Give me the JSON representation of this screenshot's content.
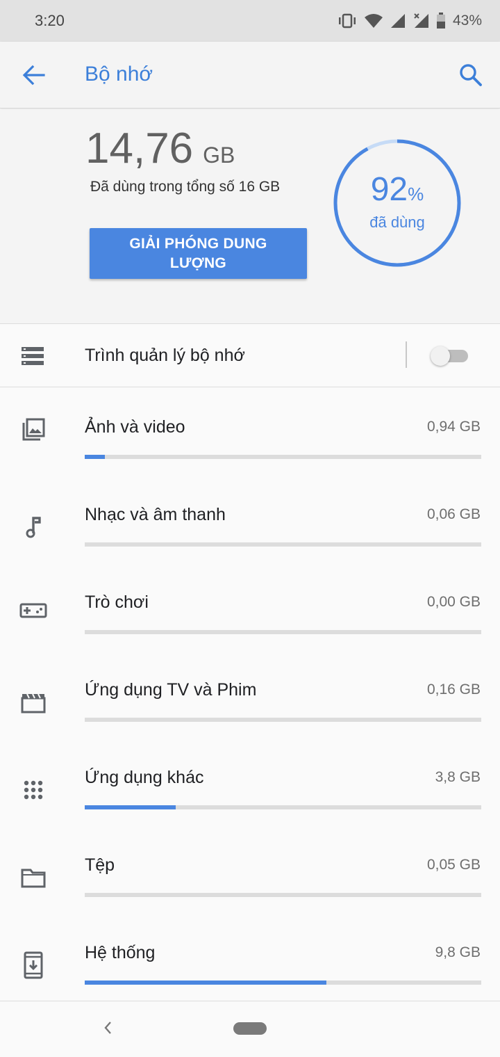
{
  "status_bar": {
    "time": "3:20",
    "battery_percent": "43%",
    "icons": [
      "vibrate-icon",
      "wifi-icon",
      "signal-icon",
      "signal-x-icon",
      "battery-icon"
    ]
  },
  "app_bar": {
    "title": "Bộ nhớ",
    "back_icon": "arrow-back-icon",
    "search_icon": "search-icon"
  },
  "summary": {
    "used_value": "14,76",
    "used_unit": "GB",
    "used_total_text": "Đã dùng trong tổng số 16 GB",
    "free_button_label": "GIẢI PHÓNG DUNG LƯỢNG",
    "percent_value": "92",
    "percent_sign": "%",
    "percent_fraction": 0.92,
    "percent_label": "đã dùng"
  },
  "storage_manager": {
    "label": "Trình quản lý bộ nhớ",
    "icon": "storage-list-icon",
    "enabled": false
  },
  "categories": [
    {
      "label": "Ảnh và video",
      "size": "0,94 GB",
      "fraction": 0.05,
      "icon": "photo-library-icon"
    },
    {
      "label": "Nhạc và âm thanh",
      "size": "0,06 GB",
      "fraction": 0.0,
      "icon": "music-note-icon"
    },
    {
      "label": "Trò chơi",
      "size": "0,00 GB",
      "fraction": 0.0,
      "icon": "gamepad-icon"
    },
    {
      "label": "Ứng dụng TV và Phim",
      "size": "0,16 GB",
      "fraction": 0.0,
      "icon": "movie-icon"
    },
    {
      "label": "Ứng dụng khác",
      "size": "3,8 GB",
      "fraction": 0.23,
      "icon": "apps-grid-icon"
    },
    {
      "label": "Tệp",
      "size": "0,05 GB",
      "fraction": 0.0,
      "icon": "folder-icon"
    },
    {
      "label": "Hệ thống",
      "size": "9,8 GB",
      "fraction": 0.61,
      "icon": "system-update-icon"
    }
  ],
  "colors": {
    "accent": "#4a86e0",
    "track": "#dcdcdc"
  }
}
